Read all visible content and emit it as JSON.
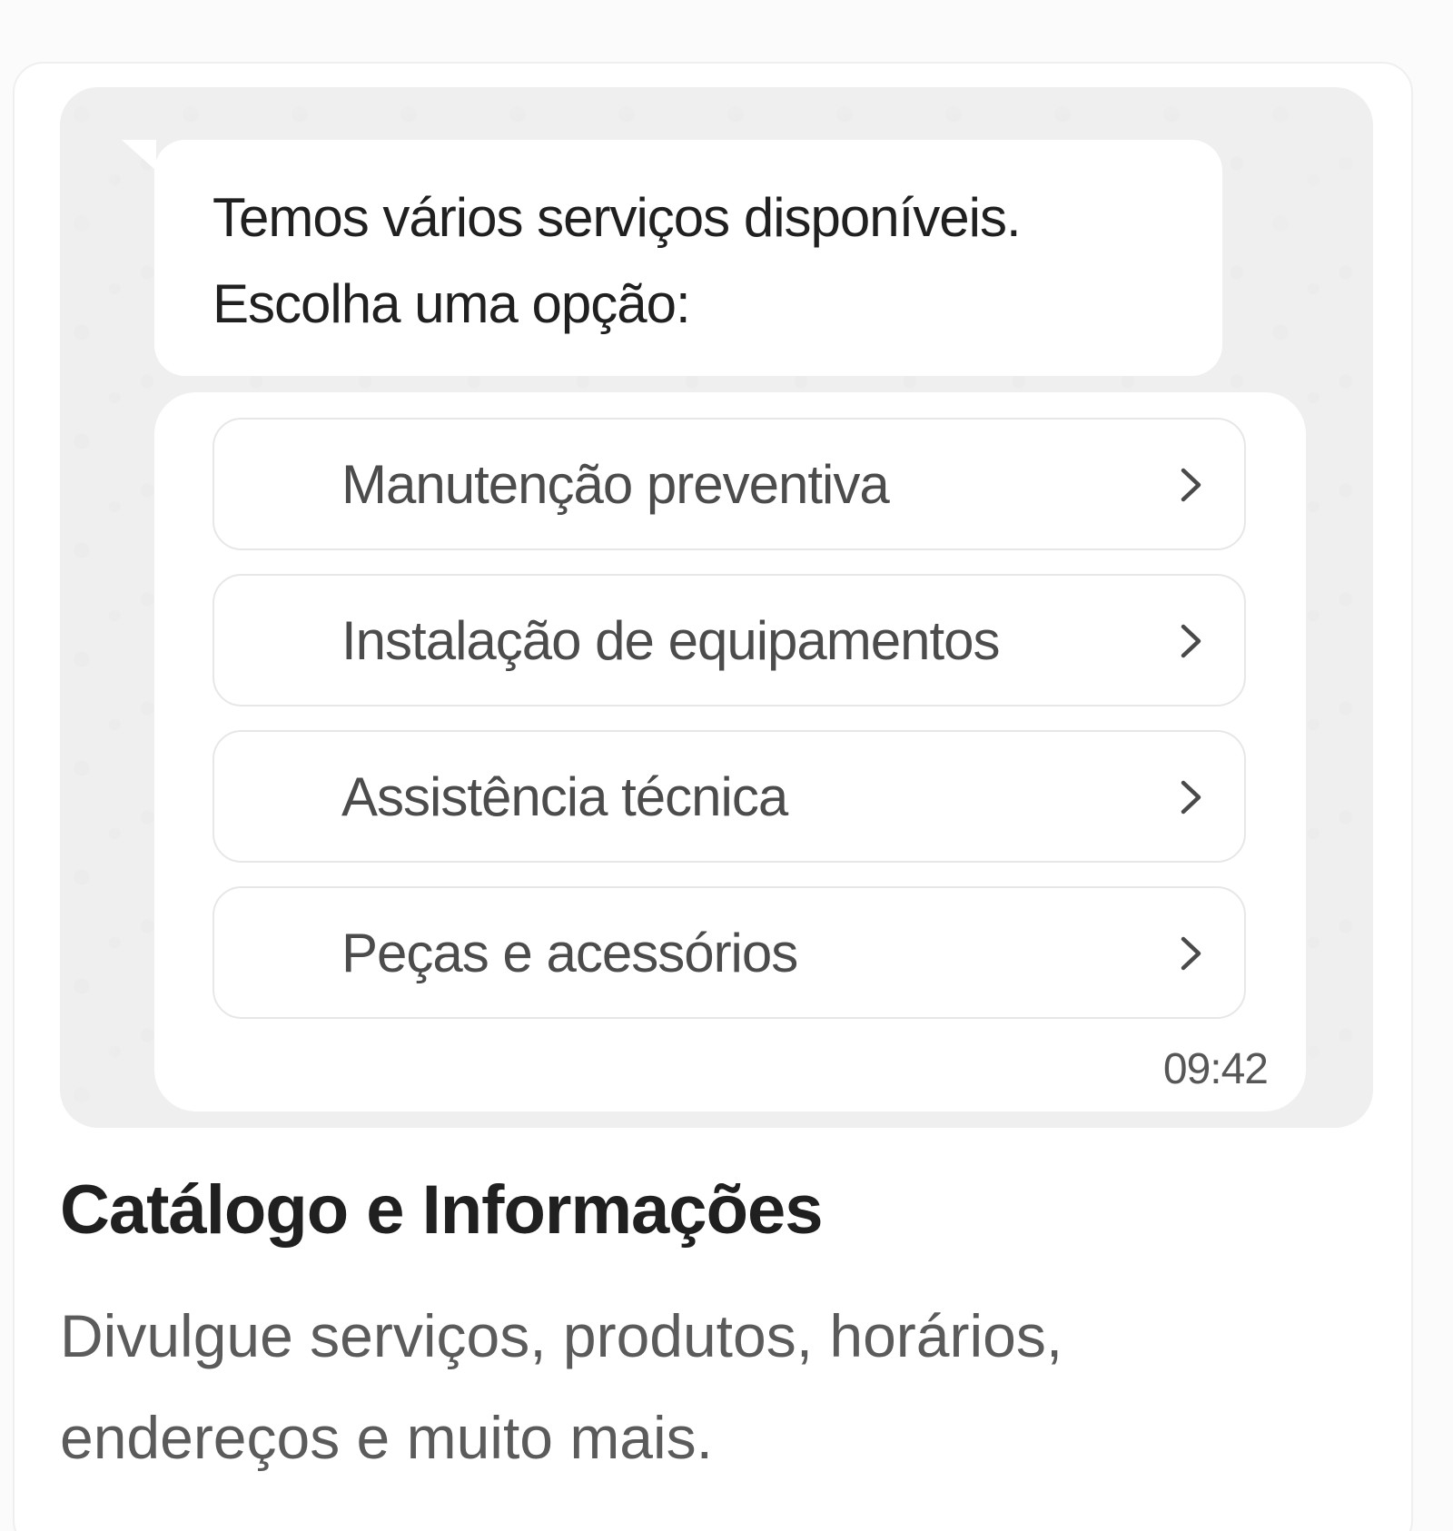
{
  "message": {
    "text": "Temos vários serviços disponíveis.\nEscolha uma opção:"
  },
  "options": [
    {
      "label": "Manutenção preventiva",
      "icon": "chevron-right-icon"
    },
    {
      "label": "Instalação de equipamentos",
      "icon": "chevron-right-icon"
    },
    {
      "label": "Assistência técnica",
      "icon": "chevron-right-icon"
    },
    {
      "label": "Peças e acessórios",
      "icon": "chevron-right-icon"
    }
  ],
  "timestamp": "09:42",
  "card": {
    "title": "Catálogo e Informações",
    "description": "Divulgue serviços, produtos, horários,\nendereços e muito mais."
  },
  "colors": {
    "page_background": "#fbfbfb",
    "card_background": "#ffffff",
    "chat_background": "#efefef",
    "text_primary": "#202020",
    "text_secondary": "#5b5b5b",
    "border": "#e7e7e7"
  }
}
